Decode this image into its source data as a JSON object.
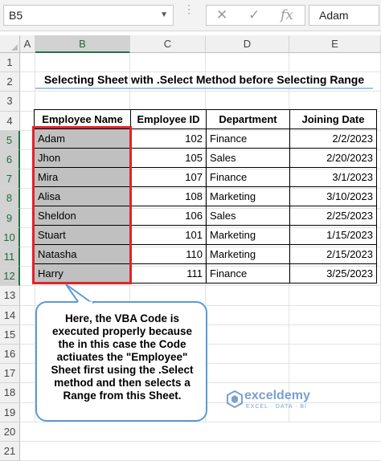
{
  "formula_bar": {
    "name_box": "B5",
    "cancel_icon": "✕",
    "enter_icon": "✓",
    "fx_icon": "fx",
    "content": "Adam"
  },
  "columns": [
    "A",
    "B",
    "C",
    "D",
    "E"
  ],
  "rows": [
    "1",
    "2",
    "3",
    "4",
    "5",
    "6",
    "7",
    "8",
    "9",
    "10",
    "11",
    "12",
    "13",
    "14",
    "15",
    "16",
    "17",
    "18",
    "19",
    "20",
    "21"
  ],
  "title": "Selecting Sheet with .Select Method before Selecting Range",
  "table": {
    "headers": [
      "Employee Name",
      "Employee ID",
      "Department",
      "Joining Date"
    ],
    "rows": [
      [
        "Adam",
        "102",
        "Finance",
        "2/2/2023"
      ],
      [
        "Jhon",
        "105",
        "Sales",
        "2/20/2023"
      ],
      [
        "Mira",
        "107",
        "Finance",
        "3/1/2023"
      ],
      [
        "Alisa",
        "108",
        "Marketing",
        "3/10/2023"
      ],
      [
        "Sheldon",
        "106",
        "Sales",
        "2/25/2023"
      ],
      [
        "Stuart",
        "101",
        "Marketing",
        "1/15/2023"
      ],
      [
        "Natasha",
        "110",
        "Marketing",
        "2/15/2023"
      ],
      [
        "Harry",
        "111",
        "Finance",
        "3/25/2023"
      ]
    ]
  },
  "callout": "Here, the VBA Code is executed properly because the in this case the Code actiuates the \"Employee\" Sheet first using the .Select method and then selects a Range from this Sheet.",
  "watermark": {
    "name": "exceldemy",
    "tagline": "EXCEL · DATA · BI"
  },
  "colors": {
    "selection_border": "#e0242b",
    "selected_cells": "#c0c0c0",
    "excel_green": "#217346",
    "callout_border": "#5b9bd5",
    "title_underline": "#9dc3e6"
  }
}
